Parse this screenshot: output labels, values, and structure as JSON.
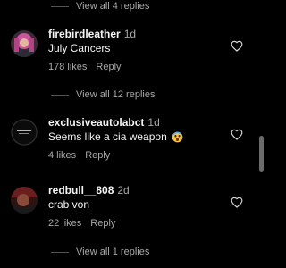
{
  "threads": [
    {
      "view_replies_label": "View all 4 replies"
    },
    {
      "view_replies_label": "View all 12 replies"
    },
    {
      "view_replies_label": "View all 1 replies"
    }
  ],
  "comments": [
    {
      "username": "firebirdleather",
      "time": "1d",
      "text": "July Cancers",
      "likes": "178 likes",
      "reply_label": "Reply",
      "avatar_icon": "profile-photo-pink-hair"
    },
    {
      "username": "exclusiveautolabct",
      "time": "1d",
      "text": "Seems like a cia weapon",
      "emoji_icon": "face-screaming-emoji",
      "likes": "4 likes",
      "reply_label": "Reply",
      "avatar_icon": "black-logo-avatar"
    },
    {
      "username": "redbull__808",
      "time": "2d",
      "text": "crab von",
      "likes": "22 likes",
      "reply_label": "Reply",
      "avatar_icon": "profile-photo-red-dark"
    }
  ],
  "colors": {
    "background": "#000000",
    "primary_text": "#f5f5f5",
    "secondary_text": "#a8a8a8",
    "scrollbar_thumb": "#6b6b6b"
  }
}
